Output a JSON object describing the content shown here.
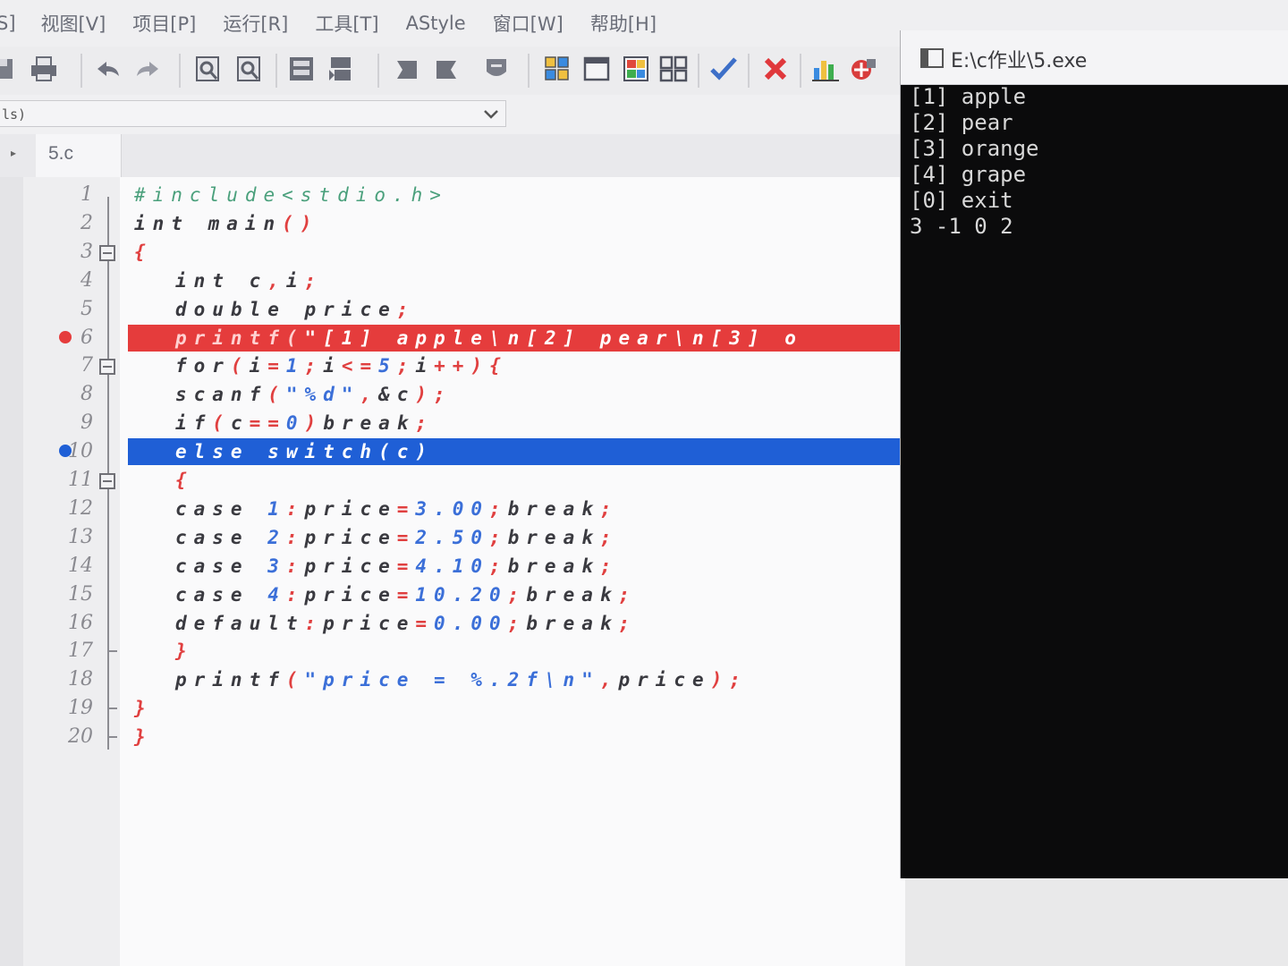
{
  "menu": [
    "S]",
    "视图[V]",
    "项目[P]",
    "运行[R]",
    "工具[T]",
    "AStyle",
    "窗口[W]",
    "帮助[H]"
  ],
  "toolbar": {
    "icons": [
      {
        "name": "save-icon"
      },
      {
        "name": "print-icon"
      },
      {
        "name": "undo-icon"
      },
      {
        "name": "redo-icon"
      },
      {
        "name": "find-icon"
      },
      {
        "name": "replace-icon"
      },
      {
        "name": "compile-icon"
      },
      {
        "name": "run-icon"
      },
      {
        "name": "back-icon"
      },
      {
        "name": "forward-icon"
      },
      {
        "name": "stop-icon"
      },
      {
        "name": "grid-icon"
      },
      {
        "name": "window-icon"
      },
      {
        "name": "color-grid-icon"
      },
      {
        "name": "tiles-icon"
      },
      {
        "name": "check-icon"
      },
      {
        "name": "close-red-icon"
      },
      {
        "name": "chart-icon"
      },
      {
        "name": "profile-icon"
      }
    ]
  },
  "combo": {
    "value": "ls)"
  },
  "tabs": [
    {
      "label": "5.c"
    }
  ],
  "editor": {
    "lines": [
      {
        "n": "1",
        "tokens": [
          {
            "t": "#include<stdio.h>",
            "c": "pre"
          }
        ],
        "indent": 0
      },
      {
        "n": "2",
        "tokens": [
          {
            "t": "int ",
            "c": "kw"
          },
          {
            "t": "main",
            "c": "dark"
          },
          {
            "t": "()",
            "c": "red"
          }
        ],
        "indent": 0
      },
      {
        "n": "3",
        "tokens": [
          {
            "t": "{",
            "c": "red"
          }
        ],
        "indent": 0,
        "fold": true
      },
      {
        "n": "4",
        "tokens": [
          {
            "t": "int ",
            "c": "kw"
          },
          {
            "t": "c",
            "c": "dark"
          },
          {
            "t": ",",
            "c": "red"
          },
          {
            "t": "i",
            "c": "dark"
          },
          {
            "t": ";",
            "c": "red"
          }
        ],
        "indent": 1
      },
      {
        "n": "5",
        "tokens": [
          {
            "t": "double ",
            "c": "kw"
          },
          {
            "t": "price",
            "c": "dark"
          },
          {
            "t": ";",
            "c": "red"
          }
        ],
        "indent": 1
      },
      {
        "n": "6",
        "tokens": [
          {
            "t": "printf(",
            "c": "pink"
          },
          {
            "t": "\"[1] apple\\n[2] pear\\n[3] o",
            "c": "white"
          }
        ],
        "indent": 1,
        "highlight": "breakpoint"
      },
      {
        "n": "7",
        "tokens": [
          {
            "t": "for",
            "c": "kw"
          },
          {
            "t": "(",
            "c": "red"
          },
          {
            "t": "i",
            "c": "dark"
          },
          {
            "t": "=",
            "c": "red"
          },
          {
            "t": "1",
            "c": "blue"
          },
          {
            "t": ";",
            "c": "red"
          },
          {
            "t": "i",
            "c": "dark"
          },
          {
            "t": "<=",
            "c": "red"
          },
          {
            "t": "5",
            "c": "blue"
          },
          {
            "t": ";",
            "c": "red"
          },
          {
            "t": "i",
            "c": "dark"
          },
          {
            "t": "++){",
            "c": "red"
          }
        ],
        "indent": 1,
        "fold": true
      },
      {
        "n": "8",
        "tokens": [
          {
            "t": "scanf",
            "c": "dark"
          },
          {
            "t": "(",
            "c": "red"
          },
          {
            "t": "\"%d\"",
            "c": "blue"
          },
          {
            "t": ",",
            "c": "red"
          },
          {
            "t": "&c",
            "c": "dark"
          },
          {
            "t": ");",
            "c": "red"
          }
        ],
        "indent": 1
      },
      {
        "n": "9",
        "tokens": [
          {
            "t": "if",
            "c": "kw"
          },
          {
            "t": "(",
            "c": "red"
          },
          {
            "t": "c",
            "c": "dark"
          },
          {
            "t": "==",
            "c": "red"
          },
          {
            "t": "0",
            "c": "blue"
          },
          {
            "t": ")",
            "c": "red"
          },
          {
            "t": "break",
            "c": "kw"
          },
          {
            "t": ";",
            "c": "red"
          }
        ],
        "indent": 1
      },
      {
        "n": "10",
        "tokens": [
          {
            "t": "else switch(c)",
            "c": "white"
          }
        ],
        "indent": 1,
        "highlight": "current"
      },
      {
        "n": "11",
        "tokens": [
          {
            "t": "{",
            "c": "red"
          }
        ],
        "indent": 1,
        "fold": true
      },
      {
        "n": "12",
        "tokens": [
          {
            "t": "case ",
            "c": "kw"
          },
          {
            "t": "1",
            "c": "blue"
          },
          {
            "t": ":",
            "c": "red"
          },
          {
            "t": "price",
            "c": "dark"
          },
          {
            "t": "=",
            "c": "red"
          },
          {
            "t": "3.00",
            "c": "blue"
          },
          {
            "t": ";",
            "c": "red"
          },
          {
            "t": "break",
            "c": "kw"
          },
          {
            "t": ";",
            "c": "red"
          }
        ],
        "indent": 1
      },
      {
        "n": "13",
        "tokens": [
          {
            "t": "case ",
            "c": "kw"
          },
          {
            "t": "2",
            "c": "blue"
          },
          {
            "t": ":",
            "c": "red"
          },
          {
            "t": "price",
            "c": "dark"
          },
          {
            "t": "=",
            "c": "red"
          },
          {
            "t": "2.50",
            "c": "blue"
          },
          {
            "t": ";",
            "c": "red"
          },
          {
            "t": "break",
            "c": "kw"
          },
          {
            "t": ";",
            "c": "red"
          }
        ],
        "indent": 1
      },
      {
        "n": "14",
        "tokens": [
          {
            "t": "case ",
            "c": "kw"
          },
          {
            "t": "3",
            "c": "blue"
          },
          {
            "t": ":",
            "c": "red"
          },
          {
            "t": "price",
            "c": "dark"
          },
          {
            "t": "=",
            "c": "red"
          },
          {
            "t": "4.10",
            "c": "blue"
          },
          {
            "t": ";",
            "c": "red"
          },
          {
            "t": "break",
            "c": "kw"
          },
          {
            "t": ";",
            "c": "red"
          }
        ],
        "indent": 1
      },
      {
        "n": "15",
        "tokens": [
          {
            "t": "case ",
            "c": "kw"
          },
          {
            "t": "4",
            "c": "blue"
          },
          {
            "t": ":",
            "c": "red"
          },
          {
            "t": "price",
            "c": "dark"
          },
          {
            "t": "=",
            "c": "red"
          },
          {
            "t": "10.20",
            "c": "blue"
          },
          {
            "t": ";",
            "c": "red"
          },
          {
            "t": "break",
            "c": "kw"
          },
          {
            "t": ";",
            "c": "red"
          }
        ],
        "indent": 1
      },
      {
        "n": "16",
        "tokens": [
          {
            "t": "default",
            "c": "kw"
          },
          {
            "t": ":",
            "c": "red"
          },
          {
            "t": "price",
            "c": "dark"
          },
          {
            "t": "=",
            "c": "red"
          },
          {
            "t": "0.00",
            "c": "blue"
          },
          {
            "t": ";",
            "c": "red"
          },
          {
            "t": "break",
            "c": "kw"
          },
          {
            "t": ";",
            "c": "red"
          }
        ],
        "indent": 1
      },
      {
        "n": "17",
        "tokens": [
          {
            "t": "}",
            "c": "red"
          }
        ],
        "indent": 1,
        "endfold": true
      },
      {
        "n": "18",
        "tokens": [
          {
            "t": "printf",
            "c": "dark"
          },
          {
            "t": "(",
            "c": "red"
          },
          {
            "t": "\"price = %.2f\\n\"",
            "c": "blue"
          },
          {
            "t": ",",
            "c": "red"
          },
          {
            "t": "price",
            "c": "dark"
          },
          {
            "t": ");",
            "c": "red"
          }
        ],
        "indent": 1
      },
      {
        "n": "19",
        "tokens": [
          {
            "t": "}",
            "c": "red"
          }
        ],
        "indent": 0,
        "endfold": true
      },
      {
        "n": "20",
        "tokens": [
          {
            "t": "}",
            "c": "red"
          }
        ],
        "indent": 0,
        "endfold": true
      }
    ]
  },
  "console": {
    "title": "E:\\c作业\\5.exe",
    "lines": [
      "[1] apple",
      "[2] pear",
      "[3] orange",
      "[4] grape",
      "[0] exit",
      "3 -1 0 2"
    ]
  },
  "colors": {
    "breakpoint_line": "#e53c3c",
    "current_line": "#1f5fd6",
    "console_bg": "#0b0b0c"
  }
}
